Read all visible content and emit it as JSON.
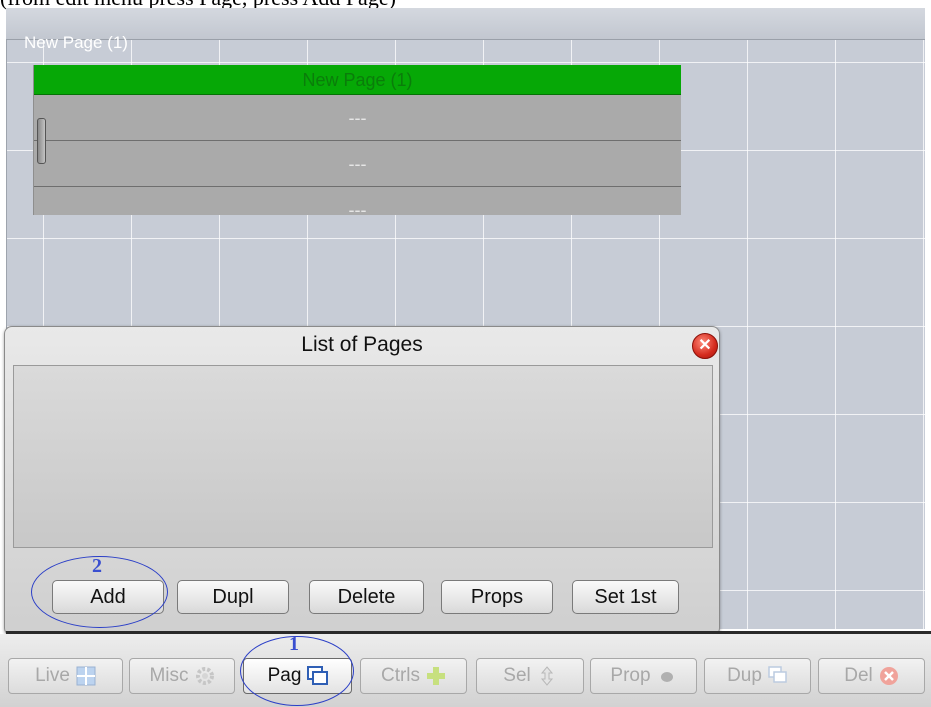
{
  "caption": "(from edit menu press Page, press Add Page)",
  "canvas": {
    "page_title": "New Page (1)"
  },
  "dialog": {
    "title": "List of Pages",
    "rows": [
      "New Page (1)",
      "---",
      "---",
      "---"
    ],
    "buttons": {
      "add": "Add",
      "dupl": "Dupl",
      "delete": "Delete",
      "props": "Props",
      "set_first": "Set 1st"
    }
  },
  "annotations": {
    "step1": "1",
    "step2": "2"
  },
  "toolbar": {
    "live": "Live",
    "misc": "Misc",
    "pag": "Pag",
    "ctrls": "Ctrls",
    "sel": "Sel",
    "prop": "Prop",
    "dup": "Dup",
    "del": "Del"
  },
  "icons": {
    "live": "grid-icon",
    "misc": "gear-icon",
    "pag": "pages-icon",
    "ctrls": "plus-icon",
    "sel": "updown-arrow-icon",
    "prop": "dot-icon",
    "dup": "duplicate-icon",
    "del": "close-icon"
  },
  "colors": {
    "selected_row": "#06a806",
    "annotation": "#2b3fc7",
    "close": "#d42a1d"
  }
}
